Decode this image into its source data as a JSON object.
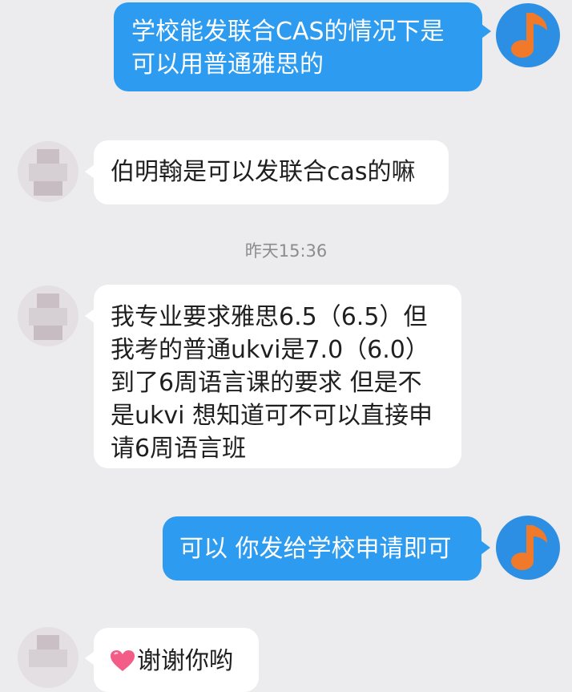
{
  "colors": {
    "outgoing_bubble": "#2d9bf0",
    "incoming_bubble": "#ffffff",
    "background": "#ececef",
    "self_avatar": "#2c8fe4",
    "self_avatar_note": "#f07a2a"
  },
  "conversation": {
    "messages": [
      {
        "sender": "self",
        "lines": [
          "学校能发联合CAS的情况下是",
          "可以用普通雅思的"
        ]
      },
      {
        "sender": "other",
        "lines": [
          "伯明翰是可以发联合cas的嘛"
        ]
      },
      {
        "sender": "other",
        "lines": [
          "我专业要求雅思6.5（6.5）但",
          "我考的普通ukvi是7.0（6.0）",
          "到了6周语言课的要求 但是不",
          "是ukvi 想知道可不可以直接申",
          "请6周语言班"
        ]
      },
      {
        "sender": "self",
        "lines": [
          "可以 你发给学校申请即可"
        ]
      },
      {
        "sender": "other",
        "emoji": "heart-emoji",
        "lines": [
          "谢谢你哟"
        ]
      }
    ],
    "timestamp": "昨天15:36"
  },
  "icons": {
    "self_avatar": "music-note-icon",
    "other_avatar": "pixelated-avatar",
    "emoji": "heart-emoji"
  }
}
